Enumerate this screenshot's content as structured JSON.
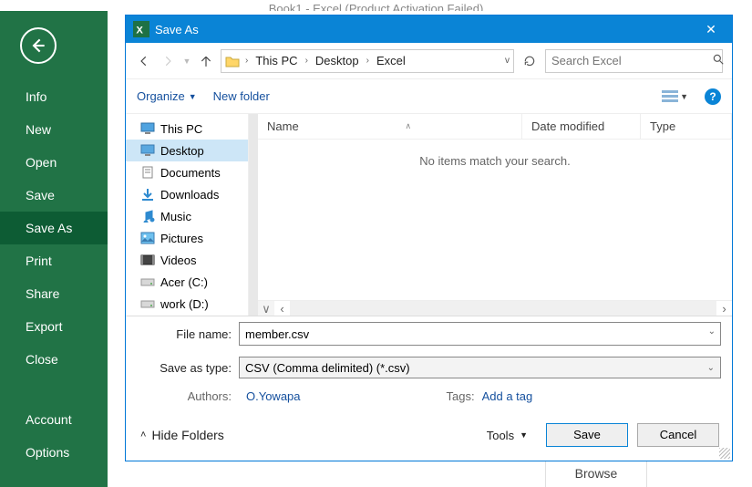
{
  "app_title": "Book1 - Excel (Product Activation Failed)",
  "sidebar": {
    "items": [
      {
        "label": "Info"
      },
      {
        "label": "New"
      },
      {
        "label": "Open"
      },
      {
        "label": "Save"
      },
      {
        "label": "Save As"
      },
      {
        "label": "Print"
      },
      {
        "label": "Share"
      },
      {
        "label": "Export"
      },
      {
        "label": "Close"
      }
    ],
    "bottom_items": [
      {
        "label": "Account"
      },
      {
        "label": "Options"
      }
    ],
    "selected": "Save As"
  },
  "browse_label": "Browse",
  "dialog": {
    "title": "Save As",
    "breadcrumbs": [
      "This PC",
      "Desktop",
      "Excel"
    ],
    "search_placeholder": "Search Excel",
    "toolbar": {
      "organize": "Organize",
      "new_folder": "New folder"
    },
    "tree": [
      {
        "icon": "monitor",
        "label": "This PC"
      },
      {
        "icon": "desktop",
        "label": "Desktop",
        "selected": true
      },
      {
        "icon": "doc",
        "label": "Documents"
      },
      {
        "icon": "download",
        "label": "Downloads"
      },
      {
        "icon": "music",
        "label": "Music"
      },
      {
        "icon": "picture",
        "label": "Pictures"
      },
      {
        "icon": "video",
        "label": "Videos"
      },
      {
        "icon": "drive",
        "label": "Acer (C:)"
      },
      {
        "icon": "drive",
        "label": "work (D:)"
      }
    ],
    "columns": {
      "name": "Name",
      "date": "Date modified",
      "type": "Type"
    },
    "empty_text": "No items match your search.",
    "filename_label": "File name:",
    "filename_value": "member.csv",
    "type_label": "Save as type:",
    "type_value": "CSV (Comma delimited) (*.csv)",
    "authors_label": "Authors:",
    "authors_value": "O.Yowapa",
    "tags_label": "Tags:",
    "tags_value": "Add a tag",
    "hide_folders": "Hide Folders",
    "tools": "Tools",
    "save": "Save",
    "cancel": "Cancel"
  }
}
